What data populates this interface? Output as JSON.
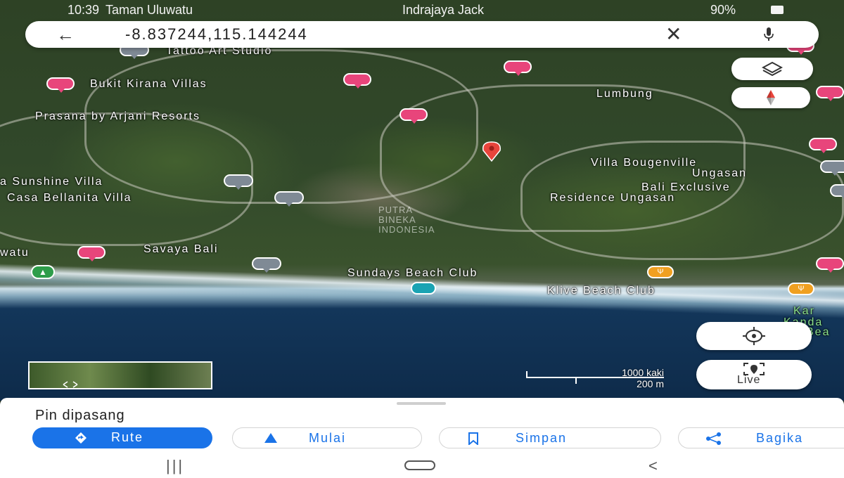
{
  "status_bar": {
    "time": "10:39",
    "left_text": "Taman Uluwatu",
    "mid_text": "Indrajaya Jack",
    "battery": "90%"
  },
  "search": {
    "query": "-8.837244,115.144244",
    "back_icon": "arrow-left-icon",
    "clear_icon": "close-icon",
    "mic_icon": "microphone-icon"
  },
  "map": {
    "labels": [
      "Tattoo Art Studio",
      "Bukit Kirana Villas",
      "Prasana by Arjani Resorts",
      "Lumbung",
      "Villa Bougenville",
      "Ungasan",
      "Bali Exclusive",
      "Residence Ungasan",
      "a Sunshine Villa",
      "Casa Bellanita Villa",
      "watu",
      "Savaya Bali",
      "Sundays Beach Club",
      "Klive Beach Club",
      "Kar",
      "Kanda",
      "Bea"
    ],
    "watermark": [
      "PUTRA",
      "BINEKA",
      "INDONESIA"
    ],
    "scale_imperial": "1000 kaki",
    "scale_metric": "200 m",
    "live_label": "Live",
    "accent_pin_color": "#e8453c"
  },
  "sheet": {
    "title": "Pin dipasang",
    "actions": [
      {
        "label": "Rute",
        "icon": "directions-icon"
      },
      {
        "label": "Mulai",
        "icon": "navigation-arrow-icon"
      },
      {
        "label": "Simpan",
        "icon": "bookmark-icon"
      },
      {
        "label": "Bagika",
        "icon": "share-icon"
      }
    ]
  },
  "navbar": {
    "recent": "|||",
    "home": "◯",
    "back": "<"
  }
}
